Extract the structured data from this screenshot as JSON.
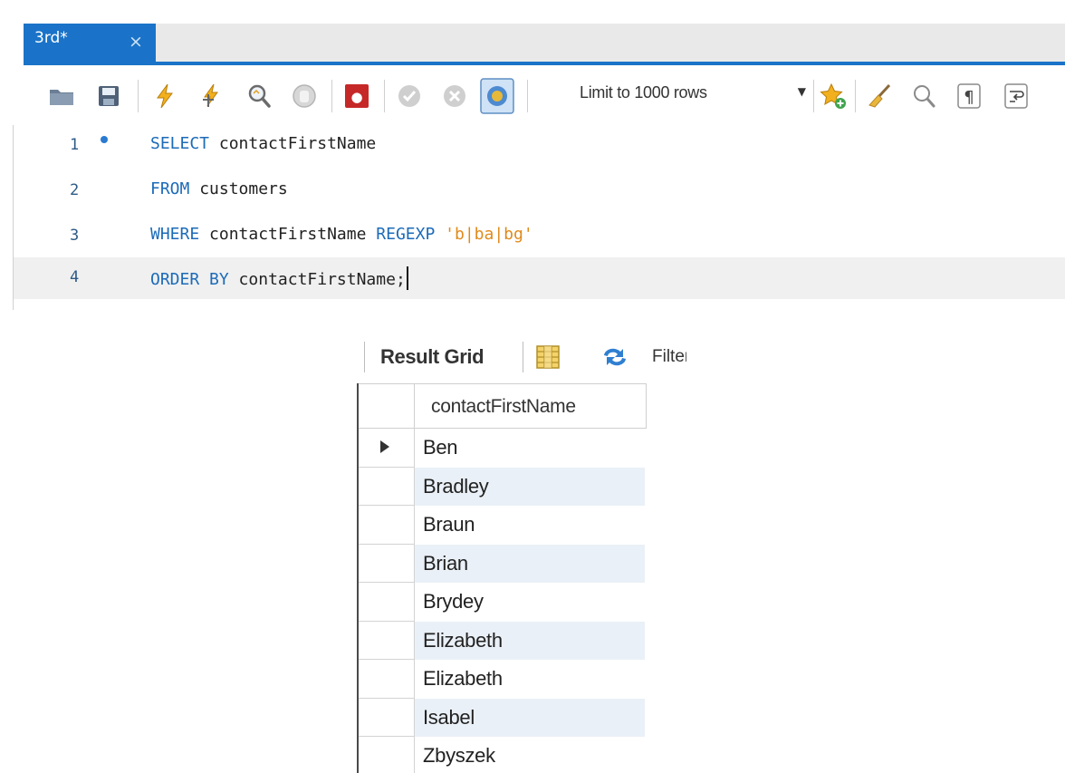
{
  "editor": {
    "tab_label": "3rd*",
    "tab_close": "×",
    "toolbar": {
      "icons": [
        "open-folder-icon",
        "save-icon",
        "execute-icon",
        "execute-current-icon",
        "explain-icon",
        "stop-icon",
        "toggle-error-icon",
        "commit-icon",
        "rollback-icon",
        "autocommit-icon",
        "bookmark-icon",
        "beautify-icon",
        "find-icon",
        "invisible-chars-icon",
        "word-wrap-icon"
      ],
      "limit_label": "Limit to 1000 rows",
      "limit_arrow": "▼"
    },
    "code_lines": [
      {
        "number": "1",
        "parts": [
          {
            "text": "SELECT",
            "kind": "kw"
          },
          {
            "text": " contactFirstName",
            "kind": "plain"
          }
        ]
      },
      {
        "number": "2",
        "parts": [
          {
            "text": "FROM",
            "kind": "kw"
          },
          {
            "text": " customers",
            "kind": "plain"
          }
        ]
      },
      {
        "number": "3",
        "parts": [
          {
            "text": "WHERE",
            "kind": "kw"
          },
          {
            "text": " contactFirstName ",
            "kind": "plain"
          },
          {
            "text": "REGEXP",
            "kind": "kw"
          },
          {
            "text": " ",
            "kind": "plain"
          },
          {
            "text": "'b|ba|bg'",
            "kind": "str"
          }
        ]
      },
      {
        "number": "4",
        "parts": [
          {
            "text": "ORDER",
            "kind": "kw"
          },
          {
            "text": " ",
            "kind": "plain"
          },
          {
            "text": "BY",
            "kind": "kw"
          },
          {
            "text": " contactFirstName;",
            "kind": "plain"
          }
        ]
      }
    ],
    "colors": {
      "keyword": "#1c6bb8",
      "string": "#e08a1a",
      "accent": "#1a73c8"
    }
  },
  "result": {
    "toolbar_title": "Result Grid",
    "filter_label": "Filter Rows:",
    "column_header": "contactFirstName",
    "rows": [
      "Ben",
      "Bradley",
      "Braun",
      "Brian",
      "Brydey",
      "Elizabeth",
      "Elizabeth",
      "Isabel",
      "Zbyszek"
    ]
  }
}
